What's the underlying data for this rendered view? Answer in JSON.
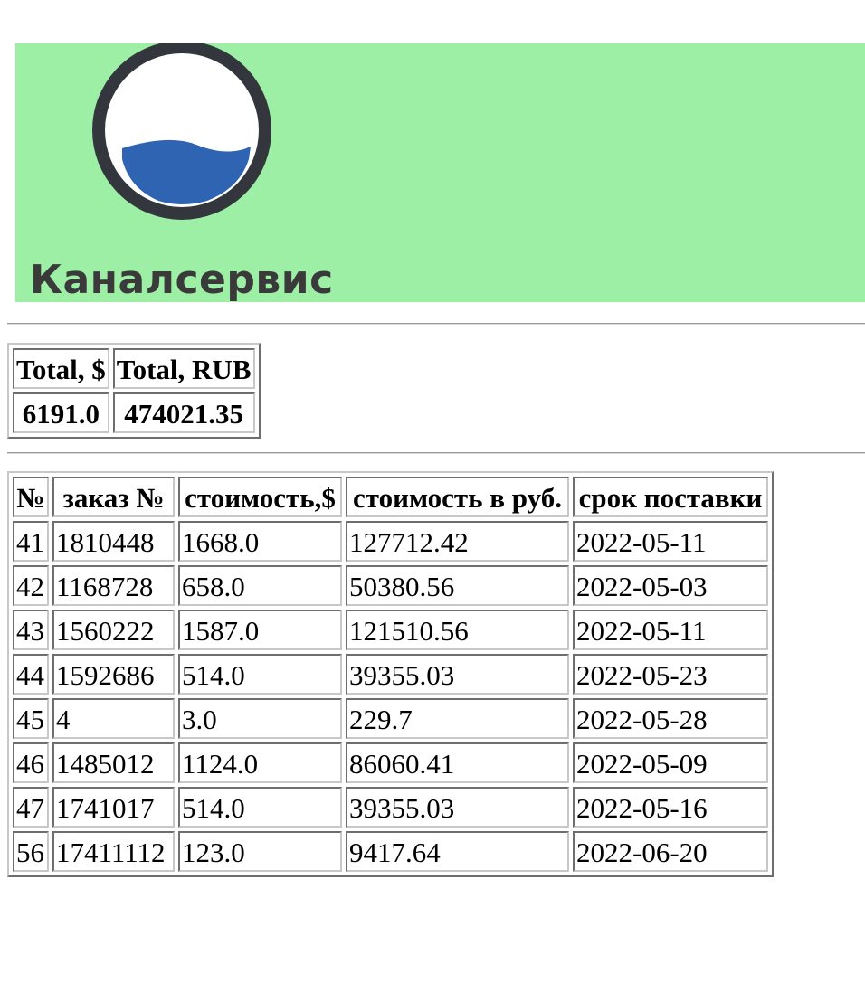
{
  "banner": {
    "brand_name": "Каналсервис",
    "logo_icon": "water-circle-logo-icon",
    "background": "#9eefa6",
    "water_color": "#2f64b3",
    "ring_color": "#33373d"
  },
  "totals": {
    "headers": [
      "Total, $",
      "Total, RUB"
    ],
    "values": [
      "6191.0",
      "474021.35"
    ]
  },
  "orders": {
    "headers": [
      "№",
      "заказ №",
      "стоимость,$",
      "стоимость в руб.",
      "срок поставки"
    ],
    "rows": [
      [
        "41",
        "1810448",
        "1668.0",
        "127712.42",
        "2022-05-11"
      ],
      [
        "42",
        "1168728",
        "658.0",
        "50380.56",
        "2022-05-03"
      ],
      [
        "43",
        "1560222",
        "1587.0",
        "121510.56",
        "2022-05-11"
      ],
      [
        "44",
        "1592686",
        "514.0",
        "39355.03",
        "2022-05-23"
      ],
      [
        "45",
        "4",
        "3.0",
        "229.7",
        "2022-05-28"
      ],
      [
        "46",
        "1485012",
        "1124.0",
        "86060.41",
        "2022-05-09"
      ],
      [
        "47",
        "1741017",
        "514.0",
        "39355.03",
        "2022-05-16"
      ],
      [
        "56",
        "17411112",
        "123.0",
        "9417.64",
        "2022-06-20"
      ]
    ]
  }
}
